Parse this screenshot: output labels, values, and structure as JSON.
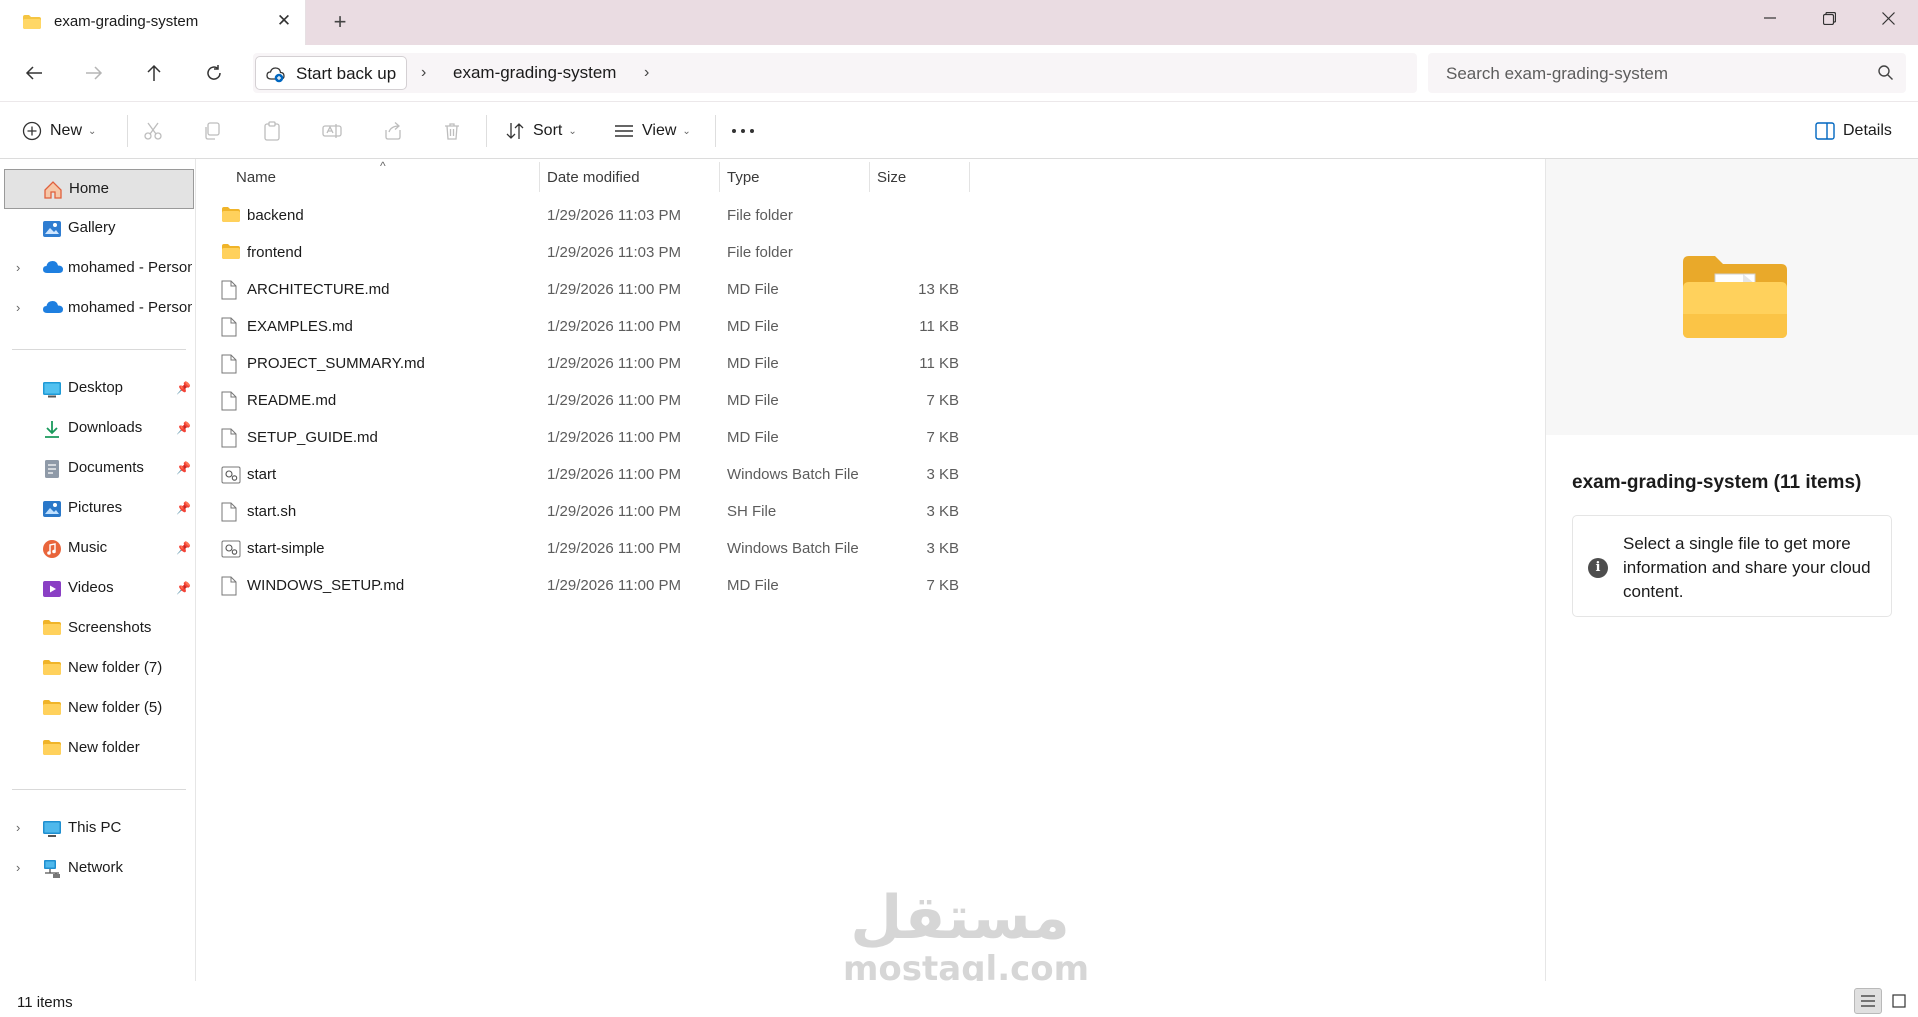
{
  "tab": {
    "title": "exam-grading-system",
    "close": "✕",
    "new_tab": "+"
  },
  "window": {
    "minimize": "minimize",
    "maximize": "restore",
    "close": "close"
  },
  "address": {
    "backup_label": "Start back up",
    "path": [
      "exam-grading-system"
    ],
    "separator": "›"
  },
  "search": {
    "placeholder": "Search exam-grading-system"
  },
  "commandbar": {
    "new_label": "New",
    "sort_label": "Sort",
    "view_label": "View",
    "more_label": "···",
    "details_label": "Details"
  },
  "sidebar": {
    "top_items": [
      {
        "label": "Home",
        "icon": "home-icon",
        "selected": true
      },
      {
        "label": "Gallery",
        "icon": "gallery-icon"
      },
      {
        "label": "mohamed - Personal",
        "icon": "onedrive-icon"
      },
      {
        "label": "mohamed - Personal",
        "icon": "onedrive-icon"
      }
    ],
    "quick_access": [
      {
        "label": "Desktop",
        "icon": "desktop-icon",
        "pinned": true
      },
      {
        "label": "Downloads",
        "icon": "download-icon",
        "pinned": true
      },
      {
        "label": "Documents",
        "icon": "documents-icon",
        "pinned": true
      },
      {
        "label": "Pictures",
        "icon": "pictures-icon",
        "pinned": true
      },
      {
        "label": "Music",
        "icon": "music-icon",
        "pinned": true
      },
      {
        "label": "Videos",
        "icon": "videos-icon",
        "pinned": true
      },
      {
        "label": "Screenshots",
        "icon": "folder-icon"
      },
      {
        "label": "New folder (7)",
        "icon": "folder-icon"
      },
      {
        "label": "New folder (5)",
        "icon": "folder-icon"
      },
      {
        "label": "New folder",
        "icon": "folder-icon"
      }
    ],
    "bottom_items": [
      {
        "label": "This PC",
        "icon": "computer-icon"
      },
      {
        "label": "Network",
        "icon": "network-icon"
      }
    ]
  },
  "filelist": {
    "columns": {
      "name": "Name",
      "date": "Date modified",
      "type": "Type",
      "size": "Size"
    },
    "sort_indicator": "^",
    "rows": [
      {
        "name": "backend",
        "date": "1/29/2026 11:03 PM",
        "type": "File folder",
        "size": "",
        "icon": "folder-icon"
      },
      {
        "name": "frontend",
        "date": "1/29/2026 11:03 PM",
        "type": "File folder",
        "size": "",
        "icon": "folder-icon"
      },
      {
        "name": "ARCHITECTURE.md",
        "date": "1/29/2026 11:00 PM",
        "type": "MD File",
        "size": "13 KB",
        "icon": "file-icon"
      },
      {
        "name": "EXAMPLES.md",
        "date": "1/29/2026 11:00 PM",
        "type": "MD File",
        "size": "11 KB",
        "icon": "file-icon"
      },
      {
        "name": "PROJECT_SUMMARY.md",
        "date": "1/29/2026 11:00 PM",
        "type": "MD File",
        "size": "11 KB",
        "icon": "file-icon"
      },
      {
        "name": "README.md",
        "date": "1/29/2026 11:00 PM",
        "type": "MD File",
        "size": "7 KB",
        "icon": "file-icon"
      },
      {
        "name": "SETUP_GUIDE.md",
        "date": "1/29/2026 11:00 PM",
        "type": "MD File",
        "size": "7 KB",
        "icon": "file-icon"
      },
      {
        "name": "start",
        "date": "1/29/2026 11:00 PM",
        "type": "Windows Batch File",
        "size": "3 KB",
        "icon": "batch-file-icon"
      },
      {
        "name": "start.sh",
        "date": "1/29/2026 11:00 PM",
        "type": "SH File",
        "size": "3 KB",
        "icon": "file-icon"
      },
      {
        "name": "start-simple",
        "date": "1/29/2026 11:00 PM",
        "type": "Windows Batch File",
        "size": "3 KB",
        "icon": "batch-file-icon"
      },
      {
        "name": "WINDOWS_SETUP.md",
        "date": "1/29/2026 11:00 PM",
        "type": "MD File",
        "size": "7 KB",
        "icon": "file-icon"
      }
    ]
  },
  "details": {
    "title": "exam-grading-system (11 items)",
    "info": "Select a single file to get more information and share your cloud content.",
    "info_icon": "i"
  },
  "watermark": {
    "arabic": "مستقل",
    "latin": "mostaql.com"
  },
  "status": {
    "items_count": "11 items"
  },
  "colors": {
    "titlebar": "#eadce2",
    "folder": "#f5c542",
    "selected": "#e3e3e3",
    "accent": "#0067c0"
  }
}
